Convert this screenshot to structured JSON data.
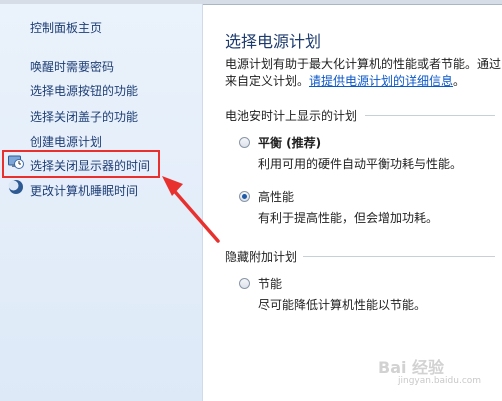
{
  "sidebar": {
    "home": "控制面板主页",
    "items": [
      {
        "label": "唤醒时需要密码"
      },
      {
        "label": "选择电源按钮的功能"
      },
      {
        "label": "选择关闭盖子的功能"
      },
      {
        "label": "创建电源计划"
      },
      {
        "label": "选择关闭显示器的时间",
        "icon": "monitor-clock-icon"
      },
      {
        "label": "更改计算机睡眠时间",
        "icon": "moon-icon"
      }
    ]
  },
  "main": {
    "title": "选择电源计划",
    "description_line1": "电源计划有助于最大化计算机的性能或者节能。通过",
    "description_line2_prefix": "来自定义计划。",
    "description_link": "请提供电源计划的详细信息",
    "description_line2_suffix": "。",
    "group1_title": "电池安时计上显示的计划",
    "group2_title": "隐藏附加计划",
    "plans": [
      {
        "name": "平衡 (推荐)",
        "desc": "利用可用的硬件自动平衡功耗与性能。",
        "selected": false,
        "bold": true
      },
      {
        "name": "高性能",
        "desc": "有利于提高性能，但会增加功耗。",
        "selected": true,
        "bold": false
      },
      {
        "name": "节能",
        "desc": "尽可能降低计算机性能以节能。",
        "selected": false,
        "bold": false
      }
    ]
  },
  "annotation": {
    "highlight_color": "#e8312e"
  },
  "watermark": {
    "text": "Bai 经验",
    "sub": "jingyan.baidu.com"
  }
}
